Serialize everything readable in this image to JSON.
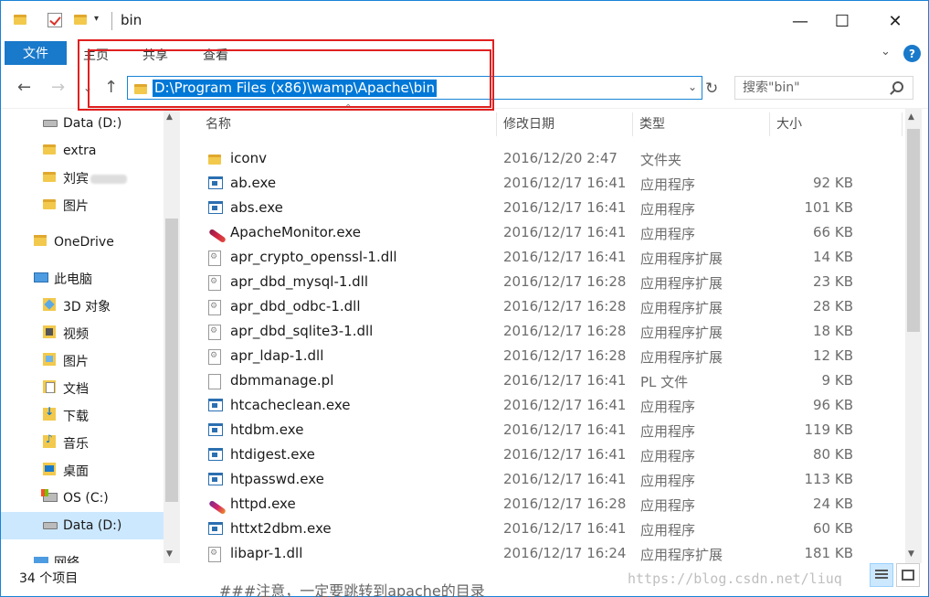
{
  "window": {
    "title": "bin",
    "minimize_glyph": "—",
    "maximize_glyph": "☐",
    "close_glyph": "✕"
  },
  "ribbon": {
    "file_tab": "文件",
    "tabs": [
      "主页",
      "共享",
      "查看"
    ],
    "expand_glyph": "⌄",
    "help_glyph": "?"
  },
  "nav": {
    "back_glyph": "←",
    "forward_glyph": "→",
    "recent_glyph": "⌄",
    "up_glyph": "↑",
    "refresh_glyph": "↻",
    "address": "D:\\Program Files (x86)\\wamp\\Apache\\bin",
    "address_dropdown_glyph": "⌄",
    "search_placeholder": "搜索\"bin\""
  },
  "sidebar": {
    "items": [
      {
        "label": "Data (D:)",
        "icon": "drive-icon"
      },
      {
        "label": "extra",
        "icon": "folder-icon"
      },
      {
        "label": "刘宾",
        "icon": "folder-icon"
      },
      {
        "label": "图片",
        "icon": "folder-icon"
      },
      {
        "label": "OneDrive",
        "icon": "onedrive-icon"
      },
      {
        "label": "此电脑",
        "icon": "pc-icon"
      },
      {
        "label": "3D 对象",
        "icon": "objects-3d-icon"
      },
      {
        "label": "视频",
        "icon": "videos-icon"
      },
      {
        "label": "图片",
        "icon": "pictures-icon"
      },
      {
        "label": "文档",
        "icon": "documents-icon"
      },
      {
        "label": "下载",
        "icon": "downloads-icon"
      },
      {
        "label": "音乐",
        "icon": "music-icon"
      },
      {
        "label": "桌面",
        "icon": "desktop-icon"
      },
      {
        "label": "OS (C:)",
        "icon": "os-drive-icon"
      },
      {
        "label": "Data (D:)",
        "icon": "drive-icon"
      },
      {
        "label": "网络",
        "icon": "network-icon"
      }
    ]
  },
  "columns": {
    "name": "名称",
    "date": "修改日期",
    "type": "类型",
    "size": "大小"
  },
  "files": [
    {
      "name": "iconv",
      "date": "2016/12/20 2:47",
      "type": "文件夹",
      "size": "",
      "icon": "folder"
    },
    {
      "name": "ab.exe",
      "date": "2016/12/17 16:41",
      "type": "应用程序",
      "size": "92 KB",
      "icon": "exe"
    },
    {
      "name": "abs.exe",
      "date": "2016/12/17 16:41",
      "type": "应用程序",
      "size": "101 KB",
      "icon": "exe"
    },
    {
      "name": "ApacheMonitor.exe",
      "date": "2016/12/17 16:41",
      "type": "应用程序",
      "size": "66 KB",
      "icon": "feather-red"
    },
    {
      "name": "apr_crypto_openssl-1.dll",
      "date": "2016/12/17 16:41",
      "type": "应用程序扩展",
      "size": "14 KB",
      "icon": "dll"
    },
    {
      "name": "apr_dbd_mysql-1.dll",
      "date": "2016/12/17 16:28",
      "type": "应用程序扩展",
      "size": "23 KB",
      "icon": "dll"
    },
    {
      "name": "apr_dbd_odbc-1.dll",
      "date": "2016/12/17 16:28",
      "type": "应用程序扩展",
      "size": "28 KB",
      "icon": "dll"
    },
    {
      "name": "apr_dbd_sqlite3-1.dll",
      "date": "2016/12/17 16:28",
      "type": "应用程序扩展",
      "size": "18 KB",
      "icon": "dll"
    },
    {
      "name": "apr_ldap-1.dll",
      "date": "2016/12/17 16:28",
      "type": "应用程序扩展",
      "size": "12 KB",
      "icon": "dll"
    },
    {
      "name": "dbmmanage.pl",
      "date": "2016/12/17 16:41",
      "type": "PL 文件",
      "size": "9 KB",
      "icon": "txt"
    },
    {
      "name": "htcacheclean.exe",
      "date": "2016/12/17 16:41",
      "type": "应用程序",
      "size": "96 KB",
      "icon": "exe"
    },
    {
      "name": "htdbm.exe",
      "date": "2016/12/17 16:41",
      "type": "应用程序",
      "size": "119 KB",
      "icon": "exe"
    },
    {
      "name": "htdigest.exe",
      "date": "2016/12/17 16:41",
      "type": "应用程序",
      "size": "80 KB",
      "icon": "exe"
    },
    {
      "name": "htpasswd.exe",
      "date": "2016/12/17 16:41",
      "type": "应用程序",
      "size": "113 KB",
      "icon": "exe"
    },
    {
      "name": "httpd.exe",
      "date": "2016/12/17 16:28",
      "type": "应用程序",
      "size": "24 KB",
      "icon": "feather"
    },
    {
      "name": "httxt2dbm.exe",
      "date": "2016/12/17 16:41",
      "type": "应用程序",
      "size": "60 KB",
      "icon": "exe"
    },
    {
      "name": "libapr-1.dll",
      "date": "2016/12/17 16:24",
      "type": "应用程序扩展",
      "size": "181 KB",
      "icon": "dll"
    }
  ],
  "status": {
    "item_count": "34 个项目"
  },
  "overlay": {
    "watermark": "https://blog.csdn.net/liuq",
    "background_text": "###注意，一定要跳转到apache的目录"
  },
  "colors": {
    "accent": "#1979ca",
    "selection": "#cce8ff",
    "annotation_red": "#e02020"
  }
}
